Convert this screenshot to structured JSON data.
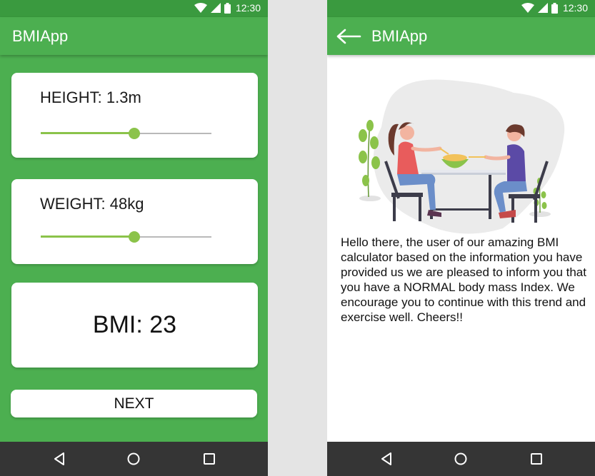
{
  "status": {
    "time": "12:30"
  },
  "screen1": {
    "app_title": "BMIApp",
    "height": {
      "label": "HEIGHT: 1.3m",
      "slider_fraction": 0.55
    },
    "weight": {
      "label": "WEIGHT: 48kg",
      "slider_fraction": 0.55
    },
    "bmi_result": "BMI: 23",
    "next_label": "NEXT"
  },
  "screen2": {
    "app_title": "BMIApp",
    "message": "Hello there, the user of our amazing BMI calculator based on the information you have provided us we are pleased to inform you that you have a NORMAL body mass Index. We encourage you to continue with this trend and exercise well. Cheers!!"
  },
  "icons": {
    "status": [
      "wifi-icon",
      "signal-icon",
      "battery-icon"
    ],
    "nav": [
      "back-triangle-icon",
      "home-circle-icon",
      "recents-square-icon"
    ],
    "appbar": "arrow-left-icon"
  },
  "colors": {
    "primary": "#4caf50",
    "status_bar": "#3a9a3f",
    "slider_accent": "#8bc34a",
    "nav_bar": "#353535",
    "divider_bg": "#e4e4e4"
  }
}
